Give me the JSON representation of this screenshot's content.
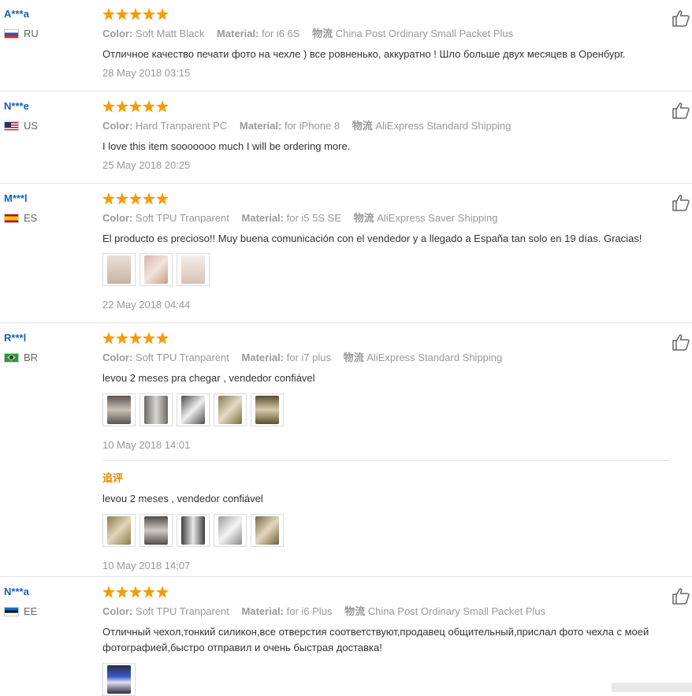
{
  "labels": {
    "color": "Color:",
    "material": "Material:",
    "shipping": "物流",
    "followup": "追评"
  },
  "reviews": [
    {
      "user": "A***a",
      "country": "RU",
      "color": "Soft Matt Black",
      "material": "for i6 6S",
      "shipping": "China Post Ordinary Small Packet Plus",
      "text": "Отличное качество печати фото на чехле ) все ровненько, аккуратно ! Шло больше двух месяцев в Оренбург.",
      "date": "28 May 2018 03:15"
    },
    {
      "user": "N***e",
      "country": "US",
      "color": "Hard Tranparent PC",
      "material": "for iPhone 8",
      "shipping": "AliExpress Standard Shipping",
      "text": "I love this item sooooooo much I will be ordering more.",
      "date": "25 May 2018 20:25"
    },
    {
      "user": "M***l",
      "country": "ES",
      "color": "Soft TPU Tranparent",
      "material": "for i5 5S SE",
      "shipping": "AliExpress Saver Shipping",
      "text": "El producto es precioso!! Muy buena comunicación con el vendedor y a llegado a España tan solo en 19 días. Gracias!",
      "date": "22 May 2018 04:44"
    },
    {
      "user": "R***l",
      "country": "BR",
      "color": "Soft TPU Tranparent",
      "material": "for i7 plus",
      "shipping": "AliExpress Standard Shipping",
      "text": "levou 2 meses pra chegar , vendedor confiável",
      "date": "10 May 2018 14:01",
      "followup_text": "levou 2 meses , vendedor confiável",
      "followup_date": "10 May 2018 14:07"
    },
    {
      "user": "N***a",
      "country": "EE",
      "color": "Soft TPU Tranparent",
      "material": "for i6 Plus",
      "shipping": "China Post Ordinary Small Packet Plus",
      "text": "Отличный чехол,тонкий силикон,все отверстия соответствуют,продавец общительный,прислал фото чехла с моей фотографией,быстро отправил и очень быстрая доставка!"
    }
  ]
}
